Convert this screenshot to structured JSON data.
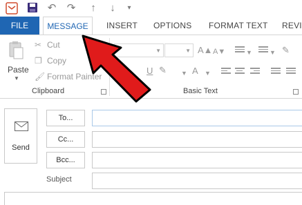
{
  "qat": {
    "icons": [
      "save-icon",
      "undo-icon",
      "redo-icon",
      "up-arrow-icon",
      "down-arrow-icon",
      "customize-qat-icon"
    ]
  },
  "tabs": {
    "file": "FILE",
    "message": "MESSAGE",
    "insert": "INSERT",
    "options": "OPTIONS",
    "format_text": "FORMAT TEXT",
    "review": "REVIE"
  },
  "ribbon": {
    "clipboard": {
      "label": "Clipboard",
      "paste": "Paste",
      "cut": "Cut",
      "copy": "Copy",
      "format_painter": "Format Painter"
    },
    "basic_text": {
      "label": "Basic Text",
      "font_size_up": "A",
      "font_size_down": "A",
      "underline": "U",
      "font_color": "A"
    }
  },
  "compose": {
    "send": "Send",
    "to": "To...",
    "cc": "Cc...",
    "bcc": "Bcc...",
    "subject_label": "Subject",
    "to_value": "",
    "cc_value": "",
    "bcc_value": "",
    "subject_value": ""
  },
  "colors": {
    "file_tab": "#1f66b3",
    "active_tab_text": "#1f66b3",
    "annotation_arrow": "#e01b1b"
  }
}
